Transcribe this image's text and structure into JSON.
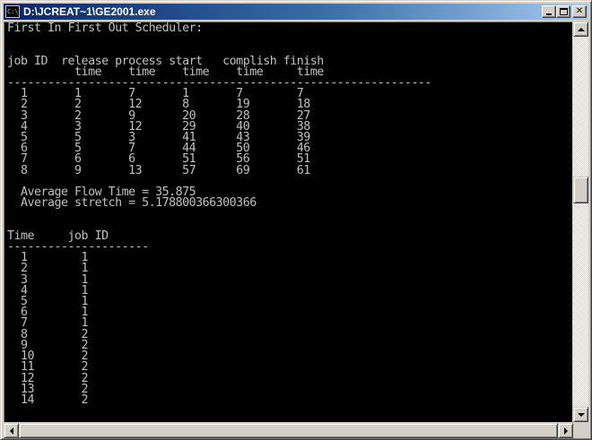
{
  "window": {
    "title": "D:\\JCREAT~1\\GE2001.exe",
    "icon_name": "console-app-icon",
    "icon_text": "C:\\"
  },
  "caption_buttons": {
    "minimize": "minimize",
    "maximize": "maximize",
    "close": "✕"
  },
  "colors": {
    "console_bg": "#000000",
    "console_fg": "#c0c0c0",
    "titlebar_start": "#0a246a",
    "titlebar_end": "#a6caf0"
  },
  "console": {
    "lines": [
      "First In First Out Scheduler:",
      "",
      "",
      "job ID  release process start   complish finish",
      "          time    time    time    time     time",
      "---------------------------------------------------------------",
      "  1       1       7       1       7        7",
      "  2       2       12      8       19       18",
      "  3       2       9       20      28       27",
      "  4       3       12      29      40       38",
      "  5       5       3       41      43       39",
      "  6       5       7       44      50       46",
      "  7       6       6       51      56       51",
      "  8       9       13      57      69       61",
      "",
      "  Average Flow Time = 35.875",
      "  Average stretch = 5.178800366300366",
      "",
      "",
      "Time     job ID",
      "---------------------",
      "  1        1",
      "  2        1",
      "  3        1",
      "  4        1",
      "  5        1",
      "  6        1",
      "  7        1",
      "  8        2",
      "  9        2",
      "  10       2",
      "  11       2",
      "  12       2",
      "  13       2",
      "  14       2"
    ]
  }
}
